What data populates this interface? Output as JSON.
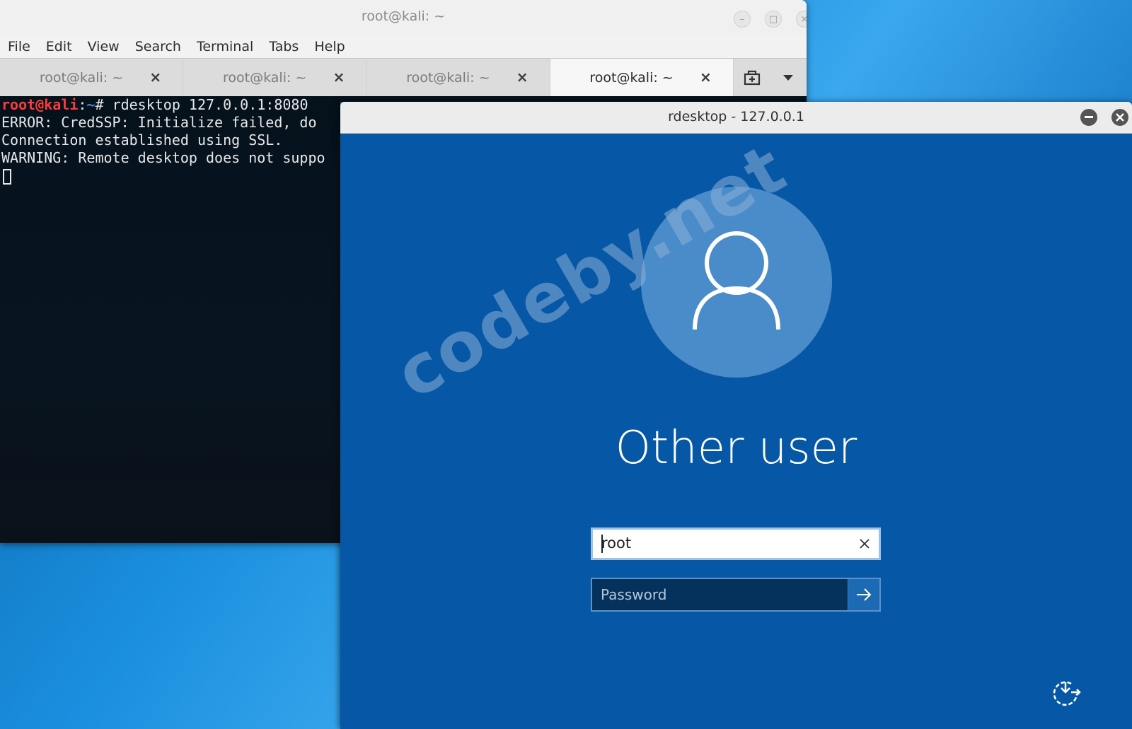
{
  "terminal": {
    "title": "root@kali: ~",
    "menu": [
      "File",
      "Edit",
      "View",
      "Search",
      "Terminal",
      "Tabs",
      "Help"
    ],
    "tabs": [
      {
        "label": "root@kali: ~",
        "close": "×",
        "active": false
      },
      {
        "label": "root@kali: ~",
        "close": "×",
        "active": false
      },
      {
        "label": "root@kali: ~",
        "close": "×",
        "active": false
      },
      {
        "label": "root@kali: ~",
        "close": "×",
        "active": true
      }
    ],
    "prompt_user": "root@kali",
    "prompt_sep": ":",
    "prompt_path": "~",
    "prompt_symbol": "# ",
    "command": "rdesktop 127.0.0.1:8080",
    "output": [
      "ERROR: CredSSP: Initialize failed, do",
      "Connection established using SSL.",
      "WARNING: Remote desktop does not suppo"
    ]
  },
  "rdesktop": {
    "title": "rdesktop - 127.0.0.1",
    "user_name": "Other user",
    "username_value": "root",
    "password_placeholder": "Password",
    "watermark": "codeby.net"
  },
  "colors": {
    "login_background": "#0658a6",
    "avatar_circle": "#4a8cc9",
    "prompt_user": "#ff3a3a",
    "prompt_path": "#4a7fd8"
  }
}
